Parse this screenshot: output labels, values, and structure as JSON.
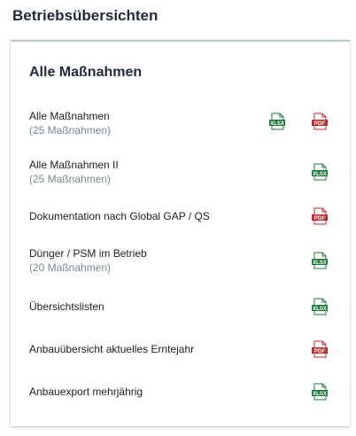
{
  "page": {
    "title": "Betriebsübersichten"
  },
  "card": {
    "title": "Alle Maßnahmen",
    "rows": [
      {
        "label": "Alle Maßnahmen",
        "sub": "(25 Maßnahmen)",
        "icons": [
          "xlsx-icon",
          "pdf-icon"
        ]
      },
      {
        "label": "Alle Maßnahmen II",
        "sub": "(25 Maßnahmen)",
        "icons": [
          "xlsx-icon"
        ]
      },
      {
        "label": "Dokumentation nach Global GAP / QS",
        "sub": "",
        "icons": [
          "pdf-icon"
        ]
      },
      {
        "label": "Dünger / PSM im Betrieb",
        "sub": "(20 Maßnahmen)",
        "icons": [
          "xlsx-icon"
        ]
      },
      {
        "label": "Übersichtslisten",
        "sub": "",
        "icons": [
          "xlsx-icon"
        ]
      },
      {
        "label": "Anbauübersicht aktuelles Erntejahr",
        "sub": "",
        "icons": [
          "pdf-icon"
        ]
      },
      {
        "label": "Anbauexport mehrjährig",
        "sub": "",
        "icons": [
          "xlsx-icon"
        ]
      }
    ]
  },
  "icon_labels": {
    "xlsx": "XLSX",
    "pdf": "PDF"
  },
  "colors": {
    "xlsx": "#1e7a3c",
    "pdf": "#c0262d",
    "muted": "#7b8898",
    "title": "#1f2a3a"
  }
}
